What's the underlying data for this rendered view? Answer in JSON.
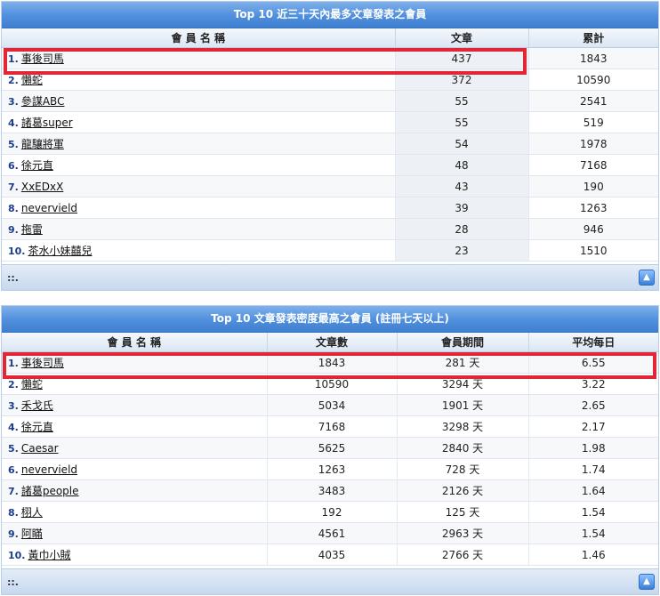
{
  "panel1": {
    "title": "Top 10 近三十天內最多文章發表之會員",
    "headers": [
      "會 員 名 稱",
      "文章",
      "累計"
    ],
    "rows": [
      {
        "rank": "1.",
        "name": "事後司馬",
        "col2": "437",
        "col3": "1843"
      },
      {
        "rank": "2.",
        "name": "懶蛇",
        "col2": "372",
        "col3": "10590"
      },
      {
        "rank": "3.",
        "name": "參謀ABC",
        "col2": "55",
        "col3": "2541"
      },
      {
        "rank": "4.",
        "name": "諸葛super",
        "col2": "55",
        "col3": "519"
      },
      {
        "rank": "5.",
        "name": "龍驤將軍",
        "col2": "54",
        "col3": "1978"
      },
      {
        "rank": "6.",
        "name": "徐元直",
        "col2": "48",
        "col3": "7168"
      },
      {
        "rank": "7.",
        "name": "XxEDxX",
        "col2": "43",
        "col3": "190"
      },
      {
        "rank": "8.",
        "name": "nevervield",
        "col2": "39",
        "col3": "1263"
      },
      {
        "rank": "9.",
        "name": "拖雷",
        "col2": "28",
        "col3": "946"
      },
      {
        "rank": "10.",
        "name": "茶水小妹囍兒",
        "col2": "23",
        "col3": "1510"
      }
    ],
    "footer": "::."
  },
  "panel2": {
    "title": "Top 10 文章發表密度最高之會員 (註冊七天以上)",
    "headers": [
      "會 員 名 稱",
      "文章數",
      "會員期間",
      "平均每日"
    ],
    "rows": [
      {
        "rank": "1.",
        "name": "事後司馬",
        "col2": "1843",
        "col3": "281 天",
        "col4": "6.55"
      },
      {
        "rank": "2.",
        "name": "懶蛇",
        "col2": "10590",
        "col3": "3294 天",
        "col4": "3.22"
      },
      {
        "rank": "3.",
        "name": "禾戈氏",
        "col2": "5034",
        "col3": "1901 天",
        "col4": "2.65"
      },
      {
        "rank": "4.",
        "name": "徐元直",
        "col2": "7168",
        "col3": "3298 天",
        "col4": "2.17"
      },
      {
        "rank": "5.",
        "name": "Caesar",
        "col2": "5625",
        "col3": "2840 天",
        "col4": "1.98"
      },
      {
        "rank": "6.",
        "name": "nevervield",
        "col2": "1263",
        "col3": "728 天",
        "col4": "1.74"
      },
      {
        "rank": "7.",
        "name": "諸葛people",
        "col2": "3483",
        "col3": "2126 天",
        "col4": "1.64"
      },
      {
        "rank": "8.",
        "name": "栩人",
        "col2": "192",
        "col3": "125 天",
        "col4": "1.54"
      },
      {
        "rank": "9.",
        "name": "阿瞞",
        "col2": "4561",
        "col3": "2963 天",
        "col4": "1.54"
      },
      {
        "rank": "10.",
        "name": "黃巾小賊",
        "col2": "4035",
        "col3": "2766 天",
        "col4": "1.46"
      }
    ],
    "footer": "::."
  },
  "colors": {
    "highlight": "#e32636",
    "header_blue": "#4f8fdd"
  },
  "icons": {
    "scroll_top": "arrow-up-icon"
  }
}
